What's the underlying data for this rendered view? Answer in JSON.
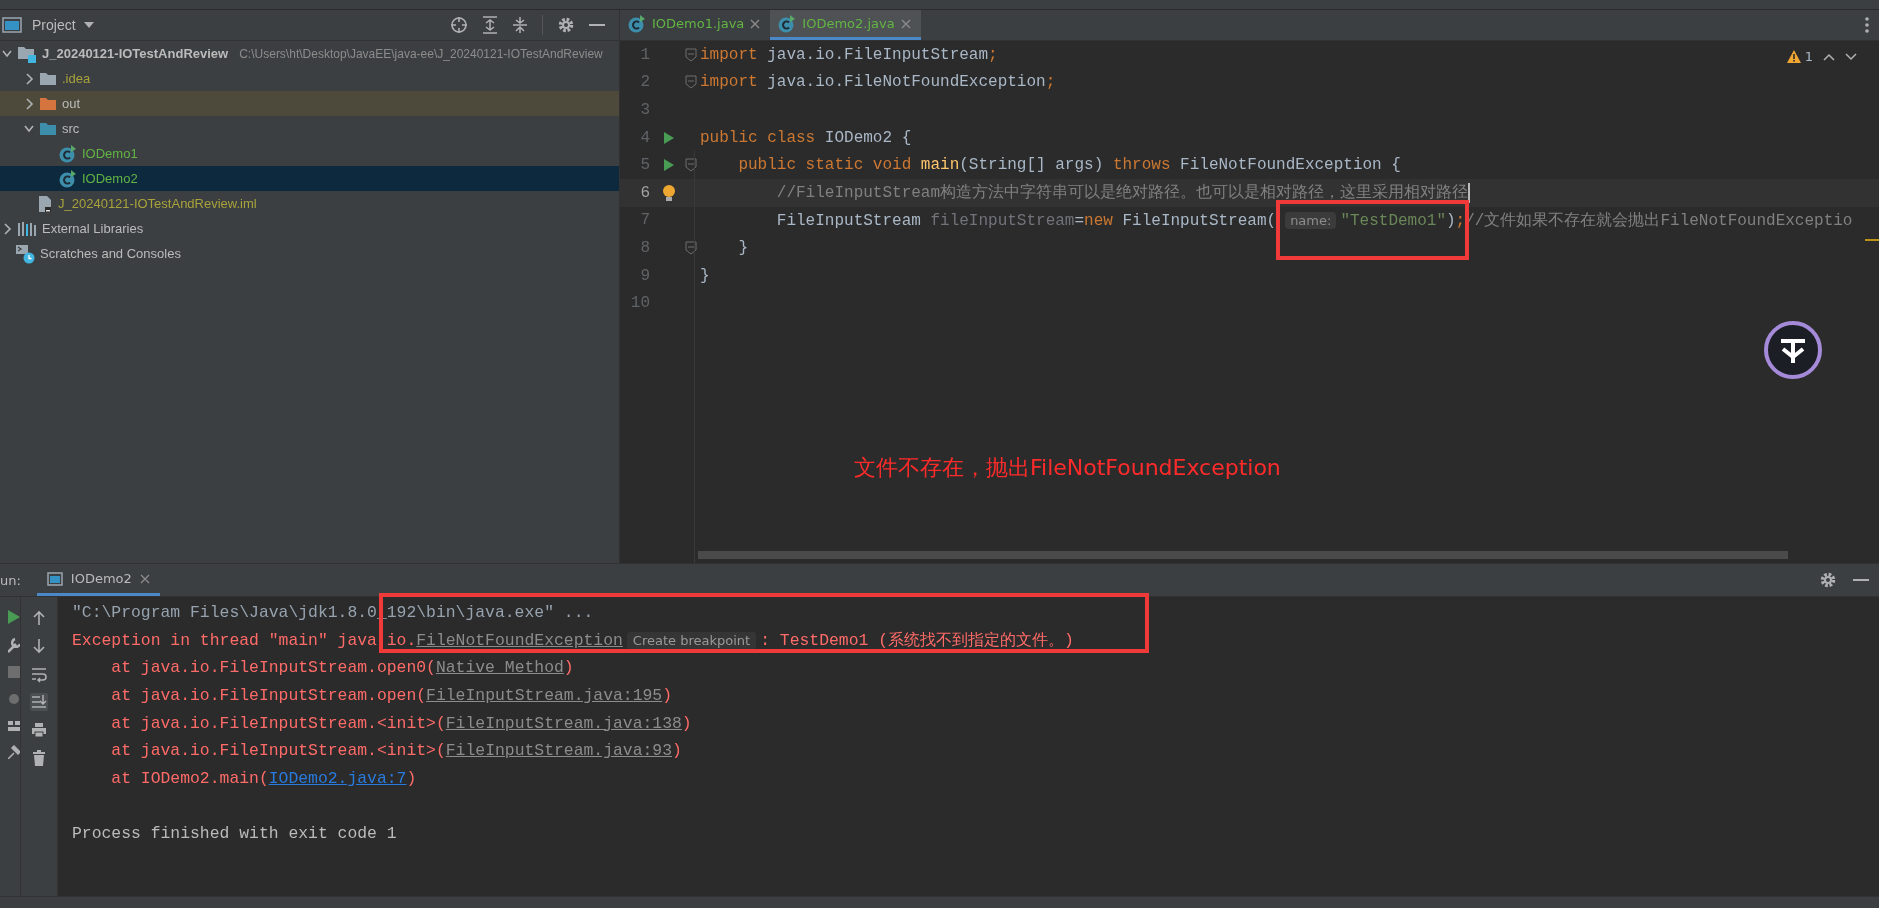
{
  "project_panel": {
    "title": "Project",
    "tree": [
      {
        "label": "J_20240121-IOTestAndReview",
        "kind": "module",
        "path": "C:\\Users\\ht\\Desktop\\JavaEE\\java-ee\\J_20240121-IOTestAndReview",
        "expanded": true,
        "selected": false,
        "color": "#bbbbbb",
        "children": [
          {
            "label": ".idea",
            "kind": "folder",
            "expanded": false,
            "selected": false,
            "color": "#a8a23c"
          },
          {
            "label": "out",
            "kind": "folder-excluded",
            "expanded": false,
            "selected": false,
            "color": "#bbbbbb"
          },
          {
            "label": "src",
            "kind": "folder-source",
            "expanded": true,
            "selected": false,
            "color": "#bbbbbb",
            "children": [
              {
                "label": "IODemo1",
                "kind": "class",
                "selected": false,
                "color": "#62b543"
              },
              {
                "label": "IODemo2",
                "kind": "class",
                "selected": true,
                "color": "#62b543"
              }
            ]
          },
          {
            "label": "J_20240121-IOTestAndReview.iml",
            "kind": "iml",
            "selected": false,
            "color": "#a8a23c"
          }
        ]
      },
      {
        "label": "External Libraries",
        "kind": "libraries",
        "expanded": false,
        "selected": false,
        "color": "#bbbbbb"
      },
      {
        "label": "Scratches and Consoles",
        "kind": "scratches",
        "selected": false,
        "color": "#bbbbbb"
      }
    ]
  },
  "editor": {
    "tabs": [
      {
        "label": "IODemo1.java",
        "kind": "class",
        "selected": false
      },
      {
        "label": "IODemo2.java",
        "kind": "class",
        "selected": true
      }
    ],
    "warnings": "1",
    "lines": [
      {
        "number": "1",
        "runnable": false,
        "bulb": false,
        "fold": true,
        "current": false,
        "tokens": [
          {
            "t": "import",
            "kind": "keyword"
          },
          {
            "t": " java.io.FileInputStream",
            "kind": "plain"
          },
          {
            "t": ";",
            "kind": "keyword"
          }
        ]
      },
      {
        "number": "2",
        "runnable": false,
        "bulb": false,
        "fold": true,
        "current": false,
        "tokens": [
          {
            "t": "import",
            "kind": "keyword"
          },
          {
            "t": " java.io.FileNotFoundException",
            "kind": "plain"
          },
          {
            "t": ";",
            "kind": "keyword"
          }
        ]
      },
      {
        "number": "3",
        "runnable": false,
        "bulb": false,
        "fold": false,
        "current": false
      },
      {
        "number": "4",
        "runnable": true,
        "bulb": false,
        "fold": false,
        "current": false,
        "tokens": [
          {
            "t": "public class",
            "kind": "keyword"
          },
          {
            "t": " IODemo2 {",
            "kind": "plain"
          }
        ]
      },
      {
        "number": "5",
        "runnable": true,
        "bulb": false,
        "fold": true,
        "current": false,
        "tokens": [
          {
            "t": "    public static void",
            "kind": "keyword"
          },
          {
            "t": " main",
            "kind": "method"
          },
          {
            "t": "(String[] args) ",
            "kind": "plain"
          },
          {
            "t": "throws",
            "kind": "keyword"
          },
          {
            "t": " FileNotFoundException {",
            "kind": "plain"
          }
        ]
      },
      {
        "number": "6",
        "runnable": false,
        "bulb": true,
        "fold": false,
        "current": true,
        "tokens": [
          {
            "t": "        //FileInputStream构造方法中字符串可以是绝对路径。也可以是相对路径，这里采用相对路径",
            "kind": "comment"
          }
        ]
      },
      {
        "number": "7",
        "runnable": false,
        "bulb": false,
        "fold": false,
        "current": false,
        "tokens": [
          {
            "t": "        FileInputStream ",
            "kind": "plain"
          },
          {
            "t": "fileInputStream",
            "kind": "unused"
          },
          {
            "t": "=",
            "kind": "plain"
          },
          {
            "t": "new",
            "kind": "keyword"
          },
          {
            "t": " FileInputStream(",
            "kind": "plain"
          },
          {
            "t": "name:",
            "kind": "hint"
          },
          {
            "t": "\"TestDemo1\"",
            "kind": "string"
          },
          {
            "t": ")",
            "kind": "plain"
          },
          {
            "t": ";",
            "kind": "keyword"
          },
          {
            "t": "//文件如果不存在就会抛出FileNotFoundExceptio",
            "kind": "comment"
          }
        ]
      },
      {
        "number": "8",
        "runnable": false,
        "bulb": false,
        "fold": true,
        "current": false,
        "tokens": [
          {
            "t": "    }",
            "kind": "plain"
          }
        ]
      },
      {
        "number": "9",
        "runnable": false,
        "bulb": false,
        "fold": false,
        "current": false,
        "tokens": [
          {
            "t": "}",
            "kind": "plain"
          }
        ]
      },
      {
        "number": "10",
        "runnable": false,
        "bulb": false,
        "fold": false,
        "current": false
      }
    ],
    "annotation": "文件不存在，抛出FileNotFoundException"
  },
  "run_panel": {
    "label": "un:",
    "tabs": [
      {
        "label": "IODemo2",
        "selected": true
      }
    ],
    "console": [
      {
        "kind": "output",
        "parts": [
          {
            "t": "\"C:\\Program Files\\Java\\jdk1.8.0_192\\bin\\java.exe\" ...",
            "kind": "command"
          }
        ]
      },
      {
        "kind": "output",
        "parts": [
          {
            "t": "Exception in thread \"main\" java.io.",
            "kind": "error"
          },
          {
            "t": "FileNotFoundException",
            "kind": "link"
          },
          {
            "t": "Create breakpoint",
            "kind": "badge"
          },
          {
            "t": ": TestDemo1 (系统找不到指定的文件。)",
            "kind": "error"
          }
        ]
      },
      {
        "kind": "output",
        "parts": [
          {
            "t": "    at java.io.FileInputStream.open0(",
            "kind": "error"
          },
          {
            "t": "Native Method",
            "kind": "link"
          },
          {
            "t": ")",
            "kind": "error"
          }
        ]
      },
      {
        "kind": "output",
        "parts": [
          {
            "t": "    at java.io.FileInputStream.open(",
            "kind": "error"
          },
          {
            "t": "FileInputStream.java:195",
            "kind": "link"
          },
          {
            "t": ")",
            "kind": "error"
          }
        ]
      },
      {
        "kind": "output",
        "parts": [
          {
            "t": "    at java.io.FileInputStream.<init>(",
            "kind": "error"
          },
          {
            "t": "FileInputStream.java:138",
            "kind": "link"
          },
          {
            "t": ")",
            "kind": "error"
          }
        ]
      },
      {
        "kind": "output",
        "parts": [
          {
            "t": "    at java.io.FileInputStream.<init>(",
            "kind": "error"
          },
          {
            "t": "FileInputStream.java:93",
            "kind": "link"
          },
          {
            "t": ")",
            "kind": "error"
          }
        ]
      },
      {
        "kind": "output",
        "parts": [
          {
            "t": "    at IODemo2.main(",
            "kind": "error"
          },
          {
            "t": "IODemo2.java:7",
            "kind": "source-link"
          },
          {
            "t": ")",
            "kind": "error"
          }
        ]
      },
      {
        "kind": "exit",
        "parts": [
          {
            "t": "Process finished with exit code 1",
            "kind": "plain"
          }
        ]
      }
    ]
  }
}
